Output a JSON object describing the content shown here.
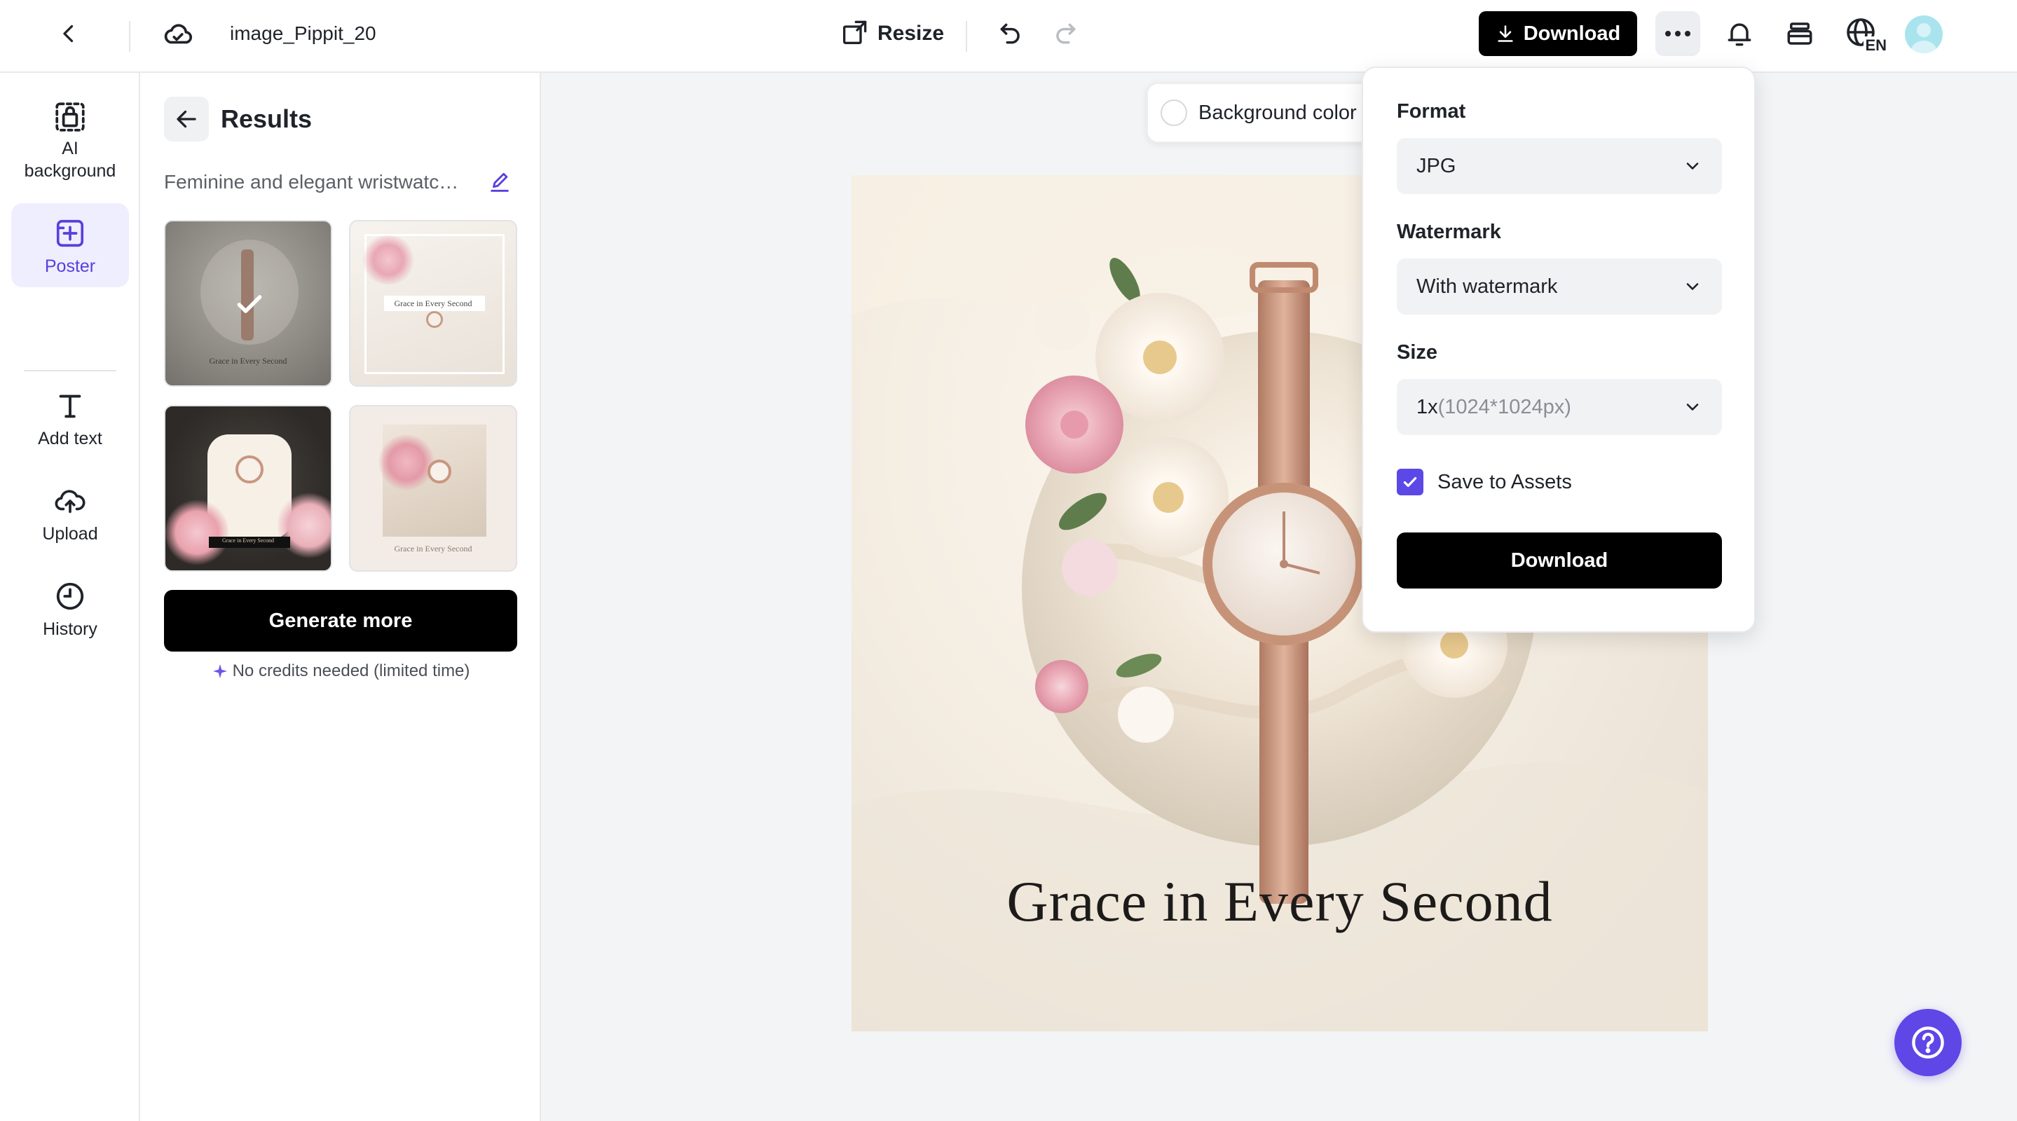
{
  "header": {
    "filename": "image_Pippit_20",
    "resize_label": "Resize",
    "download_label": "Download",
    "language_code": "EN"
  },
  "rail": {
    "items": [
      {
        "label": "AI background",
        "icon": "lock-bag-icon"
      },
      {
        "label": "Poster",
        "icon": "poster-icon"
      },
      {
        "label": "Add text",
        "icon": "text-icon"
      },
      {
        "label": "Upload",
        "icon": "upload-cloud-icon"
      },
      {
        "label": "History",
        "icon": "clock-icon"
      }
    ],
    "active": "Poster"
  },
  "panel": {
    "title": "Results",
    "prompt": "Feminine and elegant wristwatch poster",
    "thumbnails": [
      {
        "caption": "Grace in Every Second",
        "selected": true
      },
      {
        "caption": "Grace in Every Second",
        "selected": false
      },
      {
        "caption": "Grace in Every Second",
        "selected": false
      },
      {
        "caption": "Grace in Every Second",
        "selected": false
      }
    ],
    "generate_label": "Generate more",
    "credits_note": "No credits needed (limited time)"
  },
  "canvas": {
    "background_color_label": "Background color",
    "poster_title": "Grace in Every Second"
  },
  "download_popover": {
    "format_label": "Format",
    "format_value": "JPG",
    "watermark_label": "Watermark",
    "watermark_value": "With watermark",
    "size_label": "Size",
    "size_value_main": "1x",
    "size_value_detail": "(1024*1024px)",
    "save_to_assets_label": "Save to Assets",
    "save_to_assets_checked": true,
    "download_label": "Download"
  },
  "colors": {
    "accent": "#5b48e6",
    "primary_button": "#000000",
    "help_button": "#5f46e6"
  }
}
